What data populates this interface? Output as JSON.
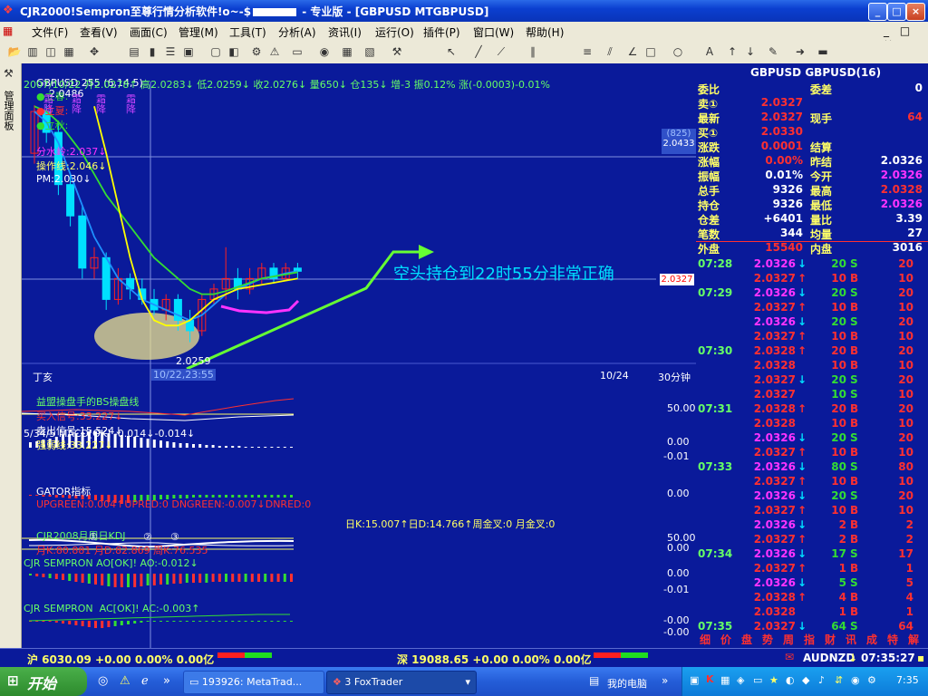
{
  "window": {
    "title": "CJR2000!Sempron至尊行情分析软件!o~-$",
    "title_rest": " - 专业版 - [GBPUSD MTGBPUSD]",
    "buttons": [
      "_",
      "□",
      "×"
    ]
  },
  "menu": [
    "文件(F)",
    "查看(V)",
    "画面(C)",
    "管理(M)",
    "工具(T)",
    "分析(A)",
    "资讯(I)",
    "运行(O)",
    "插件(P)",
    "窗口(W)",
    "帮助(H)"
  ],
  "menu_right": "_ □ ×",
  "leftbar": {
    "label": "管理面板"
  },
  "main": {
    "info1": "GBPUSD 255 (6,14,5)",
    "info1_parts": [
      "●立春:",
      "●立夏:",
      "●立秋:",
      "分水岭:2.037↓",
      "操作线:2.046↓",
      "PM:2.030↓"
    ],
    "info2": "2007/10/22 开2.0278↑ 高2.0283↓ 低2.0259↓ 收2.0276↓ 量650↓ 仓135↓ 增-3 振0.12% 涨(-0.0003)-0.01%",
    "high_label": "2.0486",
    "low_label": "2.0259",
    "top_labels": [
      "霜降",
      "霜降",
      "霜降",
      "霜降"
    ],
    "ref_box": [
      "(825)",
      "2.0433"
    ],
    "current_price_tag": "2.0327",
    "annotation": "空头持仓到22时55分非常正确",
    "date_box": "10/22,23:55",
    "date_right": "10/24",
    "period": "30分钟",
    "label_dinghai": "丁亥"
  },
  "indicators": {
    "bs": {
      "name": "益盟操盘手的BS操盘线",
      "buy": "买入信号:33.227↓",
      "sell": "卖出信号:15.524↓",
      "strong": "强弱线:33.227↓",
      "scale": [
        "50.00"
      ]
    },
    "macd": {
      "name": "5/34/5 MACD[OK] -0.014↓-0.014↓",
      "scale": [
        "0.00",
        "-0.01"
      ]
    },
    "gator": {
      "name": "GATOR指标",
      "params": "UPGREEN:0.004↑UPRED:0 DNGREEN:-0.007↓DNRED:0",
      "scale": [
        "0.00"
      ]
    },
    "kdj": {
      "name": "CJR2008月周日KDJ",
      "params": "月K:80.881 月D:82.869 周K:76.535",
      "params2": "日K:15.007↑日D:14.766↑周金叉:0 月金叉:0",
      "marks": [
        "①",
        "②",
        "③"
      ],
      "scale": [
        "50.00",
        "0.00"
      ]
    },
    "ao": {
      "name": "CJR SEMPRON AO[OK]! AO:-0.012↓",
      "scale": [
        "0.00",
        "-0.01"
      ]
    },
    "ac": {
      "name": "CJR SEMPRON  AC[OK]! AC:-0.003↑",
      "scale": [
        "-0.00",
        "-0.00"
      ]
    }
  },
  "quote": {
    "header": "GBPUSD GBPUSD(16)",
    "rows": [
      {
        "l1": "委比",
        "v1": "",
        "l2": "委差",
        "v2": "0"
      },
      {
        "l1": "卖①",
        "v1": "2.0327",
        "l2": "",
        "v2": ""
      },
      {
        "l1": "最新",
        "v1": "2.0327",
        "l2": "现手",
        "v2": "64"
      },
      {
        "l1": "买①",
        "v1": "2.0330",
        "l2": "",
        "v2": ""
      },
      {
        "l1": "涨跌",
        "v1": "0.0001",
        "l2": "结算",
        "v2": ""
      },
      {
        "l1": "涨幅",
        "v1": "0.00%",
        "l2": "昨结",
        "v2": "2.0326"
      },
      {
        "l1": "振幅",
        "v1": "0.01%",
        "l2": "今开",
        "v2": "2.0326"
      },
      {
        "l1": "总手",
        "v1": "9326",
        "l2": "最高",
        "v2": "2.0328"
      },
      {
        "l1": "持仓",
        "v1": "9326",
        "l2": "最低",
        "v2": "2.0326"
      },
      {
        "l1": "仓差",
        "v1": "+6401",
        "l2": "量比",
        "v2": "3.39"
      },
      {
        "l1": "笔数",
        "v1": "344",
        "l2": "均量",
        "v2": "27"
      },
      {
        "l1": "外盘",
        "v1": "15540",
        "l2": "内盘",
        "v2": "3016"
      }
    ],
    "ticks": [
      {
        "t": "07:28",
        "p": "2.0326",
        "d": "↓",
        "v": "20",
        "s": "S",
        "n": "20"
      },
      {
        "t": "",
        "p": "2.0327",
        "d": "↑",
        "v": "10",
        "s": "B",
        "n": "10"
      },
      {
        "t": "07:29",
        "p": "2.0326",
        "d": "↓",
        "v": "20",
        "s": "S",
        "n": "20"
      },
      {
        "t": "",
        "p": "2.0327",
        "d": "↑",
        "v": "10",
        "s": "B",
        "n": "10"
      },
      {
        "t": "",
        "p": "2.0326",
        "d": "↓",
        "v": "20",
        "s": "S",
        "n": "20"
      },
      {
        "t": "",
        "p": "2.0327",
        "d": "↑",
        "v": "10",
        "s": "B",
        "n": "10"
      },
      {
        "t": "07:30",
        "p": "2.0328",
        "d": "↑",
        "v": "20",
        "s": "B",
        "n": "20"
      },
      {
        "t": "",
        "p": "2.0328",
        "d": "",
        "v": "10",
        "s": "B",
        "n": "10"
      },
      {
        "t": "",
        "p": "2.0327",
        "d": "↓",
        "v": "20",
        "s": "S",
        "n": "20"
      },
      {
        "t": "",
        "p": "2.0327",
        "d": "",
        "v": "10",
        "s": "S",
        "n": "10"
      },
      {
        "t": "07:31",
        "p": "2.0328",
        "d": "↑",
        "v": "20",
        "s": "B",
        "n": "20"
      },
      {
        "t": "",
        "p": "2.0328",
        "d": "",
        "v": "10",
        "s": "B",
        "n": "10"
      },
      {
        "t": "",
        "p": "2.0326",
        "d": "↓",
        "v": "20",
        "s": "S",
        "n": "20"
      },
      {
        "t": "",
        "p": "2.0327",
        "d": "↑",
        "v": "10",
        "s": "B",
        "n": "10"
      },
      {
        "t": "07:33",
        "p": "2.0326",
        "d": "↓",
        "v": "80",
        "s": "S",
        "n": "80"
      },
      {
        "t": "",
        "p": "2.0327",
        "d": "↑",
        "v": "10",
        "s": "B",
        "n": "10"
      },
      {
        "t": "",
        "p": "2.0326",
        "d": "↓",
        "v": "20",
        "s": "S",
        "n": "20"
      },
      {
        "t": "",
        "p": "2.0327",
        "d": "↑",
        "v": "10",
        "s": "B",
        "n": "10"
      },
      {
        "t": "",
        "p": "2.0326",
        "d": "↓",
        "v": "2",
        "s": "B",
        "n": "2"
      },
      {
        "t": "",
        "p": "2.0327",
        "d": "↑",
        "v": "2",
        "s": "B",
        "n": "2"
      },
      {
        "t": "07:34",
        "p": "2.0326",
        "d": "↓",
        "v": "17",
        "s": "S",
        "n": "17"
      },
      {
        "t": "",
        "p": "2.0327",
        "d": "↑",
        "v": "1",
        "s": "B",
        "n": "1"
      },
      {
        "t": "",
        "p": "2.0326",
        "d": "↓",
        "v": "5",
        "s": "S",
        "n": "5"
      },
      {
        "t": "",
        "p": "2.0328",
        "d": "↑",
        "v": "4",
        "s": "B",
        "n": "4"
      },
      {
        "t": "",
        "p": "2.0328",
        "d": "",
        "v": "1",
        "s": "B",
        "n": "1"
      },
      {
        "t": "07:35",
        "p": "2.0327",
        "d": "↓",
        "v": "64",
        "s": "S",
        "n": "64"
      }
    ],
    "tabs": [
      "细",
      "价",
      "盘",
      "势",
      "周",
      "指",
      "财",
      "讯",
      "成",
      "特",
      "解"
    ]
  },
  "status": {
    "sh": "沪 6030.09 +0.00 0.00% 0.00亿",
    "sz": "深 19088.65 +0.00 0.00% 0.00亿",
    "pair": "AUDNZD",
    "time": "07:35:27"
  },
  "taskbar": {
    "start": "开始",
    "tasks": [
      "193926: MetaTrad...",
      "3 FoxTrader"
    ],
    "mypc": "我的电脑",
    "clock": "7:35"
  },
  "colors": {
    "bg": "#0a1a9a",
    "up": "#ff2020",
    "down": "#00e0ff",
    "ma_green": "#33dd33",
    "ma_yellow": "#ffff00",
    "ma_blue": "#1e90ff",
    "magenta": "#ff33ff"
  },
  "chart_data": {
    "type": "line",
    "title": "GBPUSD 255 (6,14,5)",
    "period": "30分钟",
    "x": [
      "10/22",
      "10/24"
    ],
    "candles": {
      "open": [
        2.044,
        2.048,
        2.046,
        2.041,
        2.038,
        2.033,
        2.034,
        2.03,
        2.032,
        2.031,
        2.03,
        2.029,
        2.03,
        2.028,
        2.027,
        2.03,
        2.031,
        2.032,
        2.031,
        2.032,
        2.033,
        2.032,
        2.033
      ],
      "close": [
        2.048,
        2.046,
        2.041,
        2.038,
        2.033,
        2.034,
        2.03,
        2.032,
        2.031,
        2.03,
        2.029,
        2.03,
        2.028,
        2.027,
        2.03,
        2.031,
        2.032,
        2.031,
        2.032,
        2.033,
        2.032,
        2.033,
        2.0327
      ],
      "high": [
        2.0486,
        2.0486,
        2.047,
        2.042,
        2.039,
        2.035,
        2.0345,
        2.033,
        2.0325,
        2.032,
        2.031,
        2.0305,
        2.0305,
        2.029,
        2.0305,
        2.0315,
        2.035,
        2.033,
        2.033,
        2.0335,
        2.0335,
        2.0335,
        2.0335
      ],
      "low": [
        2.043,
        2.045,
        2.04,
        2.037,
        2.032,
        2.032,
        2.029,
        2.0295,
        2.03,
        2.0295,
        2.0285,
        2.028,
        2.027,
        2.0259,
        2.0265,
        2.0295,
        2.03,
        2.03,
        2.0305,
        2.0315,
        2.0315,
        2.0318,
        2.032
      ]
    },
    "series": [
      {
        "name": "立春",
        "color": "#1e90ff",
        "values": [
          2.048,
          2.047,
          2.045,
          2.042,
          2.039,
          2.036,
          2.034,
          2.032,
          2.031,
          2.03,
          2.0295,
          2.029,
          2.0285,
          2.028,
          2.0285,
          2.0295,
          2.0305,
          2.031,
          2.0315,
          2.032,
          2.0322,
          2.0325,
          2.0327
        ]
      },
      {
        "name": "立夏",
        "color": "#33dd33",
        "values": [
          2.0485,
          2.048,
          2.047,
          2.0455,
          2.044,
          2.042,
          2.04,
          2.0385,
          2.037,
          2.0355,
          2.034,
          2.033,
          2.032,
          2.031,
          2.0305,
          2.0305,
          2.0308,
          2.0312,
          2.0316,
          2.032,
          2.0322,
          2.0324,
          2.0326
        ]
      },
      {
        "name": "立秋",
        "color": "#ffff00",
        "values": [
          null,
          null,
          null,
          null,
          null,
          2.0485,
          2.044,
          2.039,
          2.034,
          2.03,
          2.028,
          2.0275,
          2.0275,
          2.028,
          2.029,
          2.03,
          2.0305,
          2.031,
          2.0312,
          2.0314,
          2.0316,
          2.0318,
          2.032
        ]
      }
    ],
    "ylim": [
      2.025,
      2.05
    ]
  }
}
